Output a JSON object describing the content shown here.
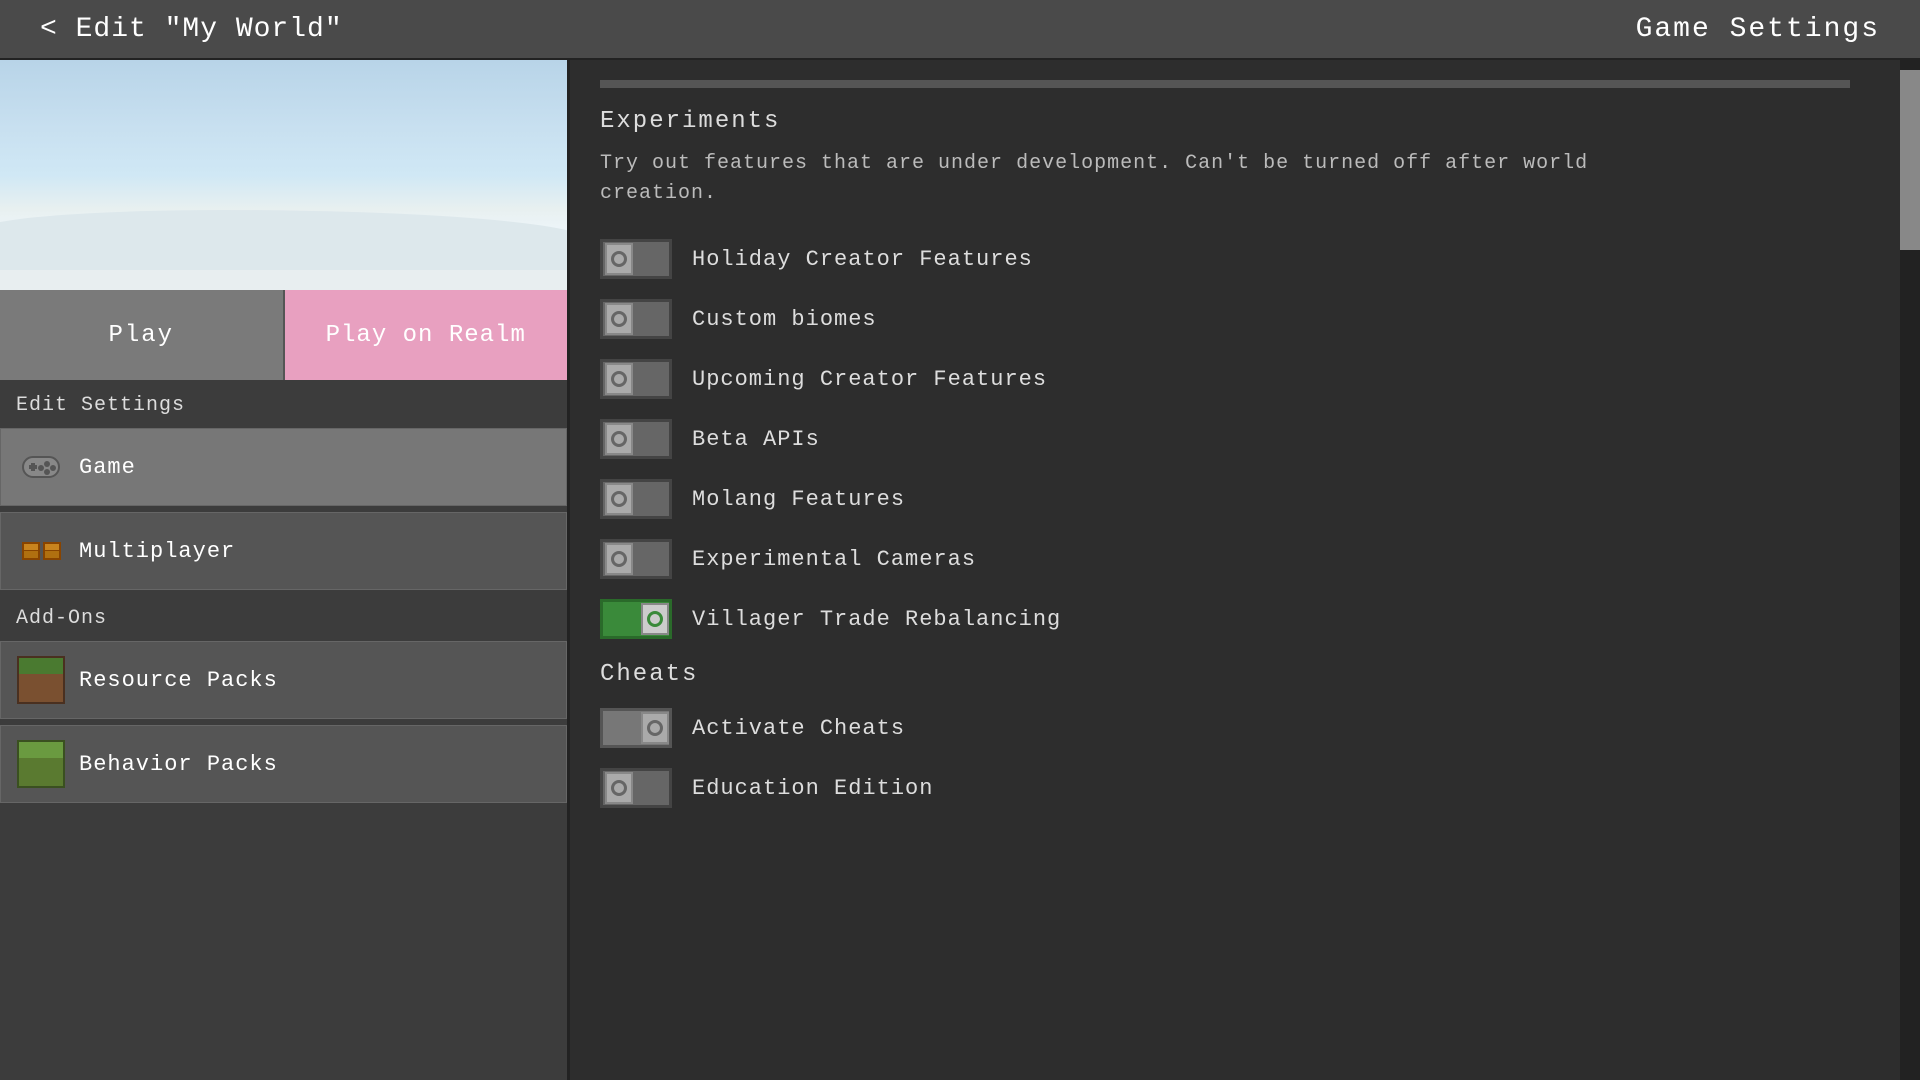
{
  "header": {
    "back_label": "< Edit \"My World\"",
    "title": "Game Settings"
  },
  "left_panel": {
    "action_buttons": {
      "play_label": "Play",
      "play_realm_label": "Play on Realm"
    },
    "edit_settings_label": "Edit Settings",
    "settings_items": [
      {
        "id": "game",
        "label": "Game",
        "active": true
      },
      {
        "id": "multiplayer",
        "label": "Multiplayer",
        "active": false
      }
    ],
    "addons_label": "Add-Ons",
    "addon_items": [
      {
        "id": "resource-packs",
        "label": "Resource Packs"
      },
      {
        "id": "behavior-packs",
        "label": "Behavior Packs"
      }
    ]
  },
  "right_panel": {
    "experiments_heading": "Experiments",
    "experiments_desc": "Try out features that are under development. Can't be turned off after world creation.",
    "experiment_items": [
      {
        "id": "holiday-creator-features",
        "label": "Holiday Creator Features",
        "enabled": false
      },
      {
        "id": "custom-biomes",
        "label": "Custom biomes",
        "enabled": false
      },
      {
        "id": "upcoming-creator-features",
        "label": "Upcoming Creator Features",
        "enabled": false
      },
      {
        "id": "beta-apis",
        "label": "Beta APIs",
        "enabled": false
      },
      {
        "id": "molang-features",
        "label": "Molang Features",
        "enabled": false
      },
      {
        "id": "experimental-cameras",
        "label": "Experimental Cameras",
        "enabled": false
      },
      {
        "id": "villager-trade-rebalancing",
        "label": "Villager Trade Rebalancing",
        "enabled": true
      }
    ],
    "cheats_heading": "Cheats",
    "cheat_items": [
      {
        "id": "activate-cheats",
        "label": "Activate Cheats",
        "enabled": true
      },
      {
        "id": "education-edition",
        "label": "Education Edition",
        "enabled": false
      }
    ]
  }
}
